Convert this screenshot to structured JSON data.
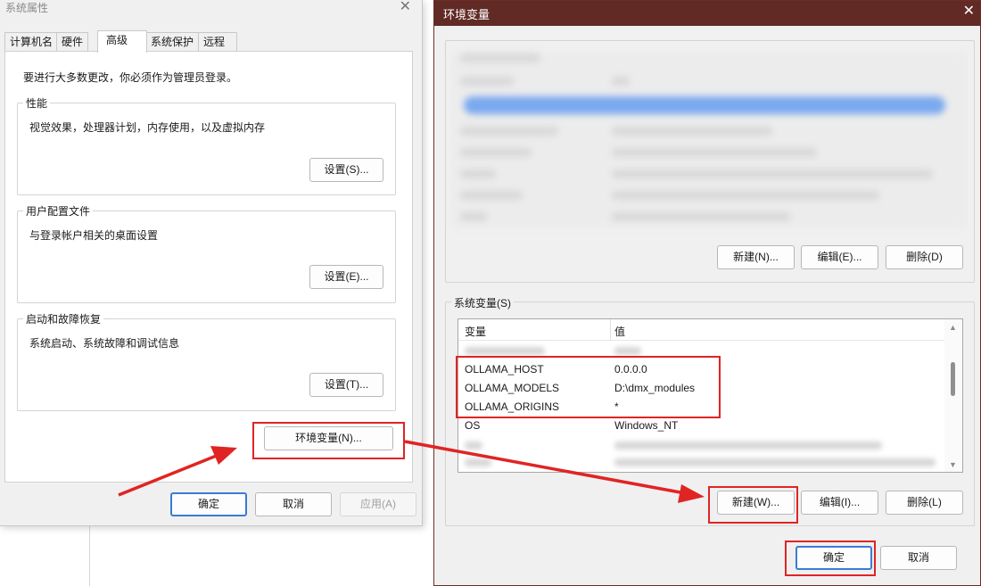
{
  "system_properties": {
    "title": "系统属性",
    "tabs": [
      {
        "label": "计算机名"
      },
      {
        "label": "硬件"
      },
      {
        "label": "高级"
      },
      {
        "label": "系统保护"
      },
      {
        "label": "远程"
      }
    ],
    "active_tab": "高级",
    "notice": "要进行大多数更改，你必须作为管理员登录。",
    "performance": {
      "title": "性能",
      "desc": "视觉效果，处理器计划，内存使用，以及虚拟内存",
      "button": "设置(S)..."
    },
    "user_profiles": {
      "title": "用户配置文件",
      "desc": "与登录帐户相关的桌面设置",
      "button": "设置(E)..."
    },
    "startup_recovery": {
      "title": "启动和故障恢复",
      "desc": "系统启动、系统故障和调试信息",
      "button": "设置(T)..."
    },
    "env_button": "环境变量(N)...",
    "ok": "确定",
    "cancel": "取消",
    "apply": "应用(A)"
  },
  "environment_variables": {
    "title": "环境变量",
    "user_buttons": {
      "new": "新建(N)...",
      "edit": "编辑(E)...",
      "delete": "删除(D)"
    },
    "system_group_title": "系统变量(S)",
    "columns": {
      "variable": "变量",
      "value": "值"
    },
    "rows": [
      {
        "name": "OLLAMA_HOST",
        "value": "0.0.0.0"
      },
      {
        "name": "OLLAMA_MODELS",
        "value": "D:\\dmx_modules"
      },
      {
        "name": "OLLAMA_ORIGINS",
        "value": "*"
      },
      {
        "name": "OS",
        "value": "Windows_NT"
      }
    ],
    "system_buttons": {
      "new": "新建(W)...",
      "edit": "编辑(I)...",
      "delete": "删除(L)"
    },
    "ok": "确定",
    "cancel": "取消"
  },
  "colors": {
    "annotation": "#e02424",
    "env_titlebar": "#612a25",
    "selection_blur": "#7aa9ee",
    "primary_border": "#3a7bd5"
  }
}
